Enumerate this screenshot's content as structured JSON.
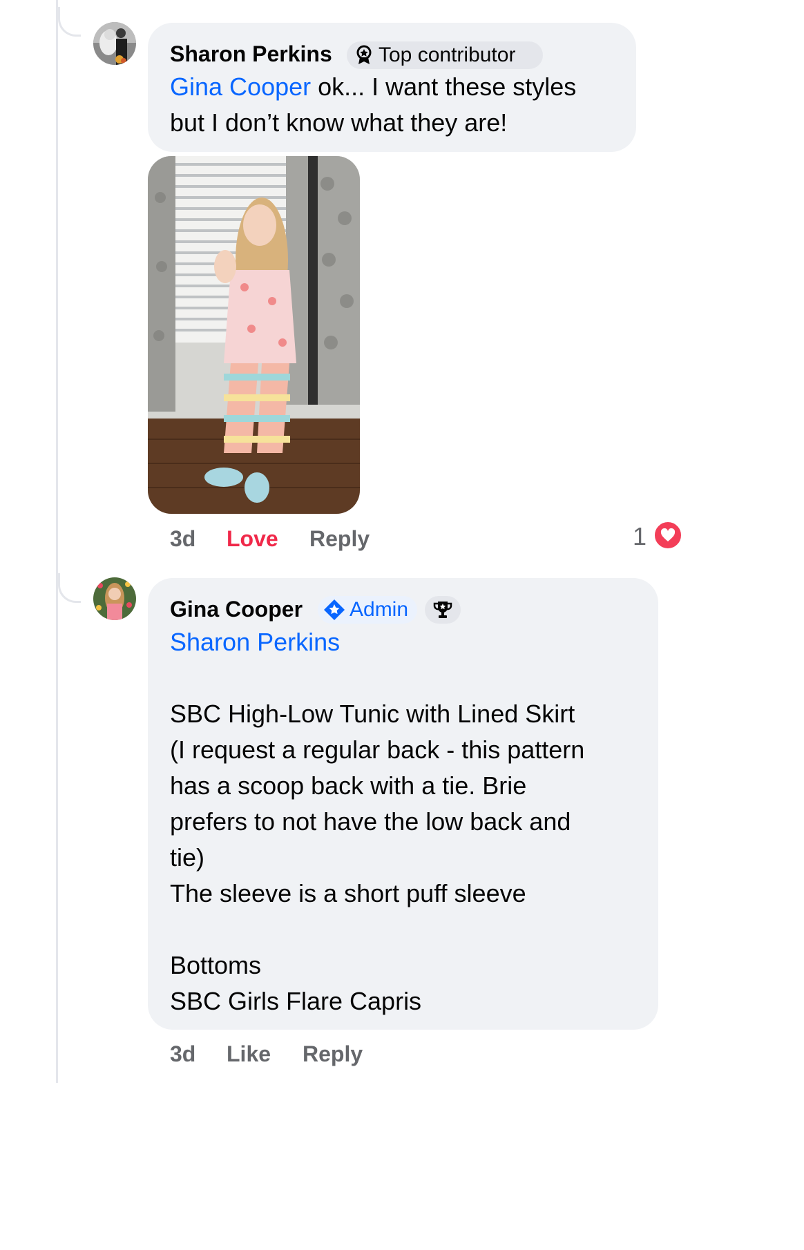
{
  "comments": [
    {
      "author": "Sharon Perkins",
      "badge": "Top contributor",
      "mention": "Gina Cooper",
      "text_line1": " ok... I want these styles",
      "text_line2": "but I don’t know what they are!",
      "time": "3d",
      "reaction_action": "Love",
      "reply_label": "Reply",
      "reaction_count": "1"
    },
    {
      "author": "Gina Cooper",
      "badge": "Admin",
      "mention": "Sharon Perkins",
      "body_lines": [
        "SBC High-Low Tunic with Lined Skirt",
        "(I request a regular back - this pattern",
        "has a scoop back with a tie. Brie",
        "prefers to not have the low back and",
        "tie)",
        "The sleeve is a short puff sleeve",
        "",
        "Bottoms",
        "SBC Girls Flare Capris"
      ],
      "time": "3d",
      "like_label": "Like",
      "reply_label": "Reply"
    }
  ],
  "colors": {
    "link_blue": "#0866ff",
    "love_red": "#f02849",
    "bubble_bg": "#f0f2f5",
    "meta_gray": "#65676b"
  },
  "icons": [
    "contributor-badge-icon",
    "admin-star-icon",
    "trophy-icon",
    "heart-reaction-icon"
  ]
}
